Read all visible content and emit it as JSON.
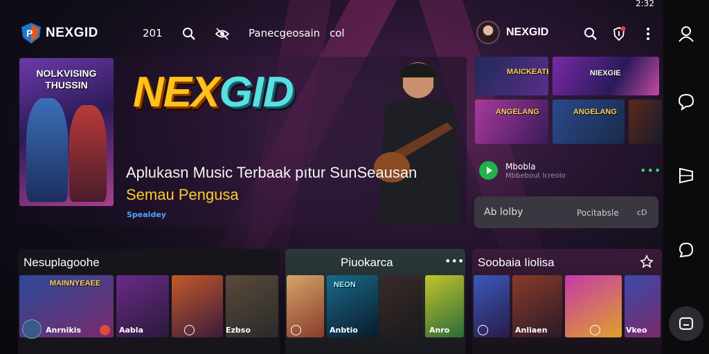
{
  "status_bar": {
    "time": "2:32"
  },
  "top_nav": {
    "brand": "NEXGID",
    "number": "201",
    "link_1": "Panecgeosain",
    "link_2": "col",
    "profile_name": "NEXGID",
    "notification_count": "1"
  },
  "hero": {
    "poster_title": "NOLKVISING THUSSIN",
    "logo_left": "NEX",
    "logo_right": "GID",
    "headline": "Aplukasn Music Terbaak pıtur SunSeausan",
    "subheadline": "Semau Pengusa",
    "tag": "Spealdey"
  },
  "right_panel": {
    "thumb_1_label": "MAICKEATER",
    "thumb_2_label": "NIEXGIE",
    "thumb_3_label": "ANGELANG",
    "thumb_4_label": "ANGELANG",
    "now_playing_title": "Mbobla",
    "now_playing_sub": "Mbbebout lcreolo",
    "search_left": "Ab lolby",
    "search_mid": "Pocitabsle",
    "search_right": "cD"
  },
  "cards": [
    {
      "title": "Nesuplagoohe",
      "foot_1": "Anrnikis",
      "foot_2": "Aabla",
      "foot_3": "Ezbso",
      "tile_label": "MAINNYEAEE"
    },
    {
      "title": "Piuokarca",
      "foot_1": "Anbtio",
      "foot_2": "Anro",
      "tile_label": "NEON"
    },
    {
      "title": "Soobaia Iiolisa",
      "foot_1": "Anliaen",
      "foot_2": "Vkeo"
    }
  ],
  "colors": {
    "accent_yellow": "#ffc21a",
    "accent_cyan": "#58e0e0",
    "play_green": "#1fb34a",
    "tag_blue": "#4aa8ff",
    "rail_bg": "#0b0b0e"
  },
  "icons": [
    "search-icon",
    "eye-icon",
    "shield-icon",
    "more-vertical-icon",
    "user-icon",
    "chat-icon",
    "flag-icon",
    "bubble-icon",
    "home-icon",
    "play-icon",
    "share-icon"
  ]
}
